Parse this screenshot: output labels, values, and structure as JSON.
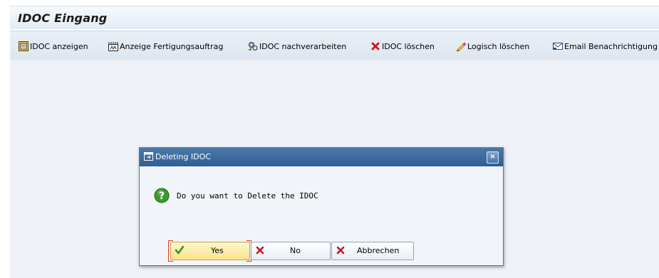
{
  "screen": {
    "title": "IDOC Eingang"
  },
  "toolbar": {
    "items": [
      {
        "label": "IDOC anzeigen",
        "icon": "display-document-icon"
      },
      {
        "label": "Anzeige Fertigungsauftrag",
        "icon": "production-order-icon"
      },
      {
        "label": "IDOC nachverarbeiten",
        "icon": "reprocess-gears-icon"
      },
      {
        "label": "IDOC löschen",
        "icon": "delete-x-icon"
      },
      {
        "label": "Logisch löschen",
        "icon": "eraser-pencil-icon"
      },
      {
        "label": "Email Benachrichtigung",
        "icon": "email-envelope-icon"
      }
    ]
  },
  "dialog": {
    "title": "Deleting IDOC",
    "message": "Do you want to Delete the IDOC",
    "close_label": "×",
    "buttons": {
      "yes": "Yes",
      "no": "No",
      "cancel": "Abbrechen"
    }
  },
  "colors": {
    "title_bar_bg": "#e3ecf5",
    "dialog_title_bg": "#2f5f95",
    "yes_button_bg": "#fbe38c",
    "focus_bracket": "#e0362b",
    "delete_red": "#d0121b",
    "check_green": "#2e9a1e"
  }
}
